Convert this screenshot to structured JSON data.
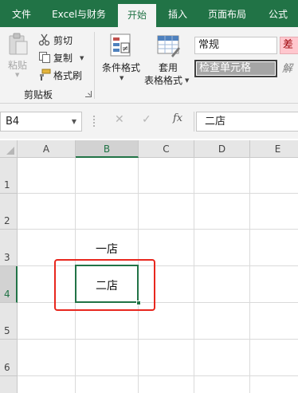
{
  "tabs": [
    {
      "label": "文件"
    },
    {
      "label": "Excel与财务"
    },
    {
      "label": "开始"
    },
    {
      "label": "插入"
    },
    {
      "label": "页面布局"
    },
    {
      "label": "公式"
    }
  ],
  "active_tab": "开始",
  "clipboard": {
    "paste_label": "粘贴",
    "cut_label": "剪切",
    "copy_label": "复制",
    "format_painter_label": "格式刷",
    "group_label": "剪贴板"
  },
  "styles": {
    "conditional_format_label": "条件格式",
    "table_format_label_line1": "套用",
    "table_format_label_line2": "表格格式",
    "style_normal": "常规",
    "style_bad": "差",
    "style_check_cell": "检查单元格",
    "style_explain": "解"
  },
  "formula_bar": {
    "name_box": "B4",
    "fx_label": "fx",
    "content": "二店"
  },
  "sheet": {
    "columns": [
      "A",
      "B",
      "C",
      "D",
      "E"
    ],
    "selected_column": "B",
    "rows": [
      "1",
      "2",
      "3",
      "4",
      "5",
      "6"
    ],
    "selected_row": "4",
    "cells": {
      "B3": "一店",
      "B4": "二店"
    }
  },
  "colors": {
    "accent": "#217346",
    "highlight_box": "#e8271e"
  }
}
